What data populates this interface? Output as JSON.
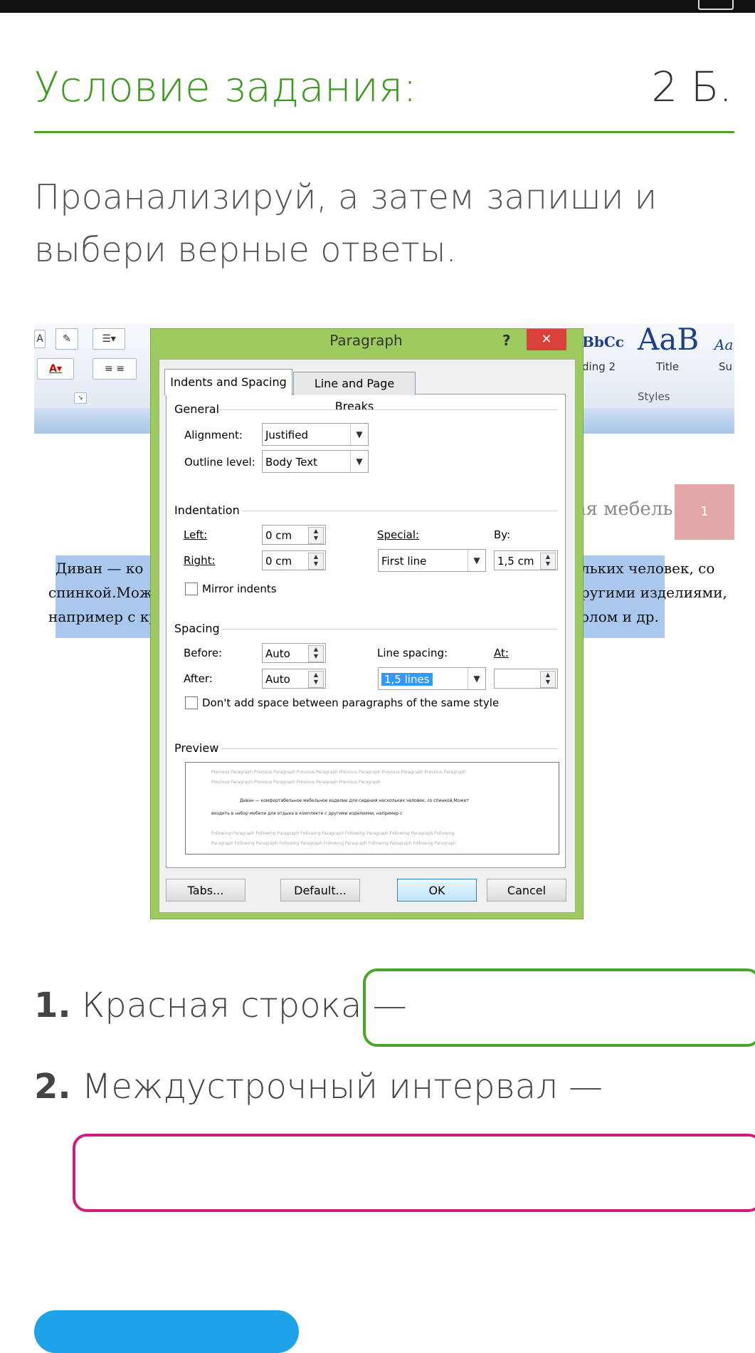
{
  "header": {
    "title": "Условие задания:",
    "points": "2 Б."
  },
  "instruction": "Проанализируй, а затем запиши и выбери верные ответы.",
  "ribbon": {
    "styles": [
      {
        "sample": "BbCc",
        "name": "ding 2"
      },
      {
        "sample": "AaB",
        "name": "Title"
      },
      {
        "sample": "Aa",
        "name": "Su"
      }
    ],
    "group_label": "Styles"
  },
  "document": {
    "heading_fragment": "ая мебель",
    "badge": "1",
    "left_lines": [
      "Диван — ко",
      "спинкой.Мож",
      "например с ку"
    ],
    "right_lines": [
      "льких человек, со",
      "ругими изделиями,",
      "олом и др."
    ]
  },
  "dialog": {
    "title": "Paragraph",
    "help": "?",
    "close": "✕",
    "tabs": [
      "Indents and Spacing",
      "Line and Page Breaks"
    ],
    "general": {
      "label": "General",
      "alignment_label": "Alignment:",
      "alignment_value": "Justified",
      "outline_label": "Outline level:",
      "outline_value": "Body Text"
    },
    "indentation": {
      "label": "Indentation",
      "left_label": "Left:",
      "left_value": "0 cm",
      "right_label": "Right:",
      "right_value": "0 cm",
      "special_label": "Special:",
      "special_value": "First line",
      "by_label": "By:",
      "by_value": "1,5 cm",
      "mirror_label": "Mirror indents"
    },
    "spacing": {
      "label": "Spacing",
      "before_label": "Before:",
      "before_value": "Auto",
      "after_label": "After:",
      "after_value": "Auto",
      "line_spacing_label": "Line spacing:",
      "line_spacing_value": "1,5 lines",
      "at_label": "At:",
      "at_value": "",
      "dont_add_label": "Don't add space between paragraphs of the same style"
    },
    "preview": {
      "label": "Preview",
      "prev1": "Previous Paragraph Previous Paragraph Previous Paragraph Previous Paragraph Previous Paragraph Previous Paragraph",
      "prev2": "Previous Paragraph Previous Paragraph Previous Paragraph Previous Paragraph",
      "main1": "Диван — комфортабельное мебельное изделие для сидения нескольких человек, со спинкой.Может",
      "main2": "входить в набор мебели для отдыха в комплекте с другими изделиями, например с",
      "next1": "Following Paragraph Following Paragraph Following Paragraph Following Paragraph Following Paragraph Following",
      "next2": "Paragraph Following Paragraph Following Paragraph Following Paragraph Following Paragraph Following Paragraph"
    },
    "buttons": {
      "tabs": "Tabs...",
      "default": "Default...",
      "ok": "OK",
      "cancel": "Cancel"
    }
  },
  "questions": [
    {
      "num": "1.",
      "text": "Красная строка —"
    },
    {
      "num": "2.",
      "text": "Междустрочный интервал —"
    }
  ],
  "colors": {
    "accent_green": "#4ba52a",
    "accent_pink": "#cc1f7a",
    "submit_blue": "#1da4e8"
  }
}
